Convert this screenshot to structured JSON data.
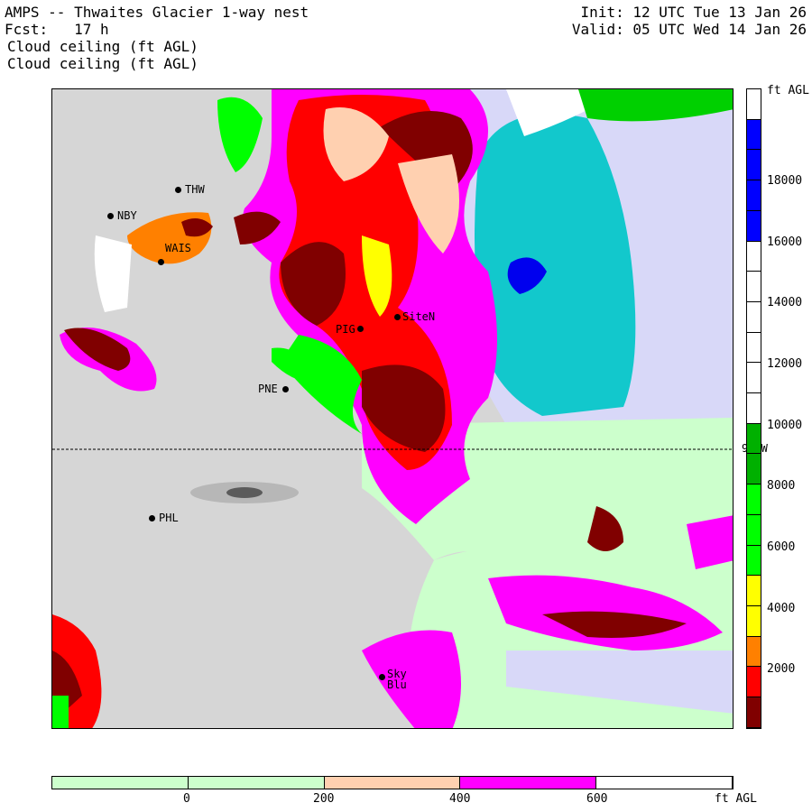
{
  "header": {
    "title": "AMPS -- Thwaites Glacier 1-way nest",
    "fcst": "Fcst:   17 h",
    "field1": "Cloud ceiling (ft AGL)",
    "field2": "Cloud ceiling (ft AGL)",
    "init": "Init: 12 UTC Tue 13 Jan 26",
    "valid": "Valid: 05 UTC Wed 14 Jan 26"
  },
  "stations": {
    "thw": "THW",
    "nby": "NBY",
    "wais": "WAIS",
    "pig": "PIG",
    "site": "SiteN",
    "pne": "PNE",
    "phl": "PHL",
    "sky": "Sky",
    "blu": "Blu"
  },
  "meridian_label": "90 W",
  "colorbar": {
    "unit": "ft AGL",
    "labels": [
      "18000",
      "16000",
      "14000",
      "12000",
      "10000",
      "8000",
      "6000",
      "4000",
      "2000"
    ],
    "bins": [
      {
        "min": 0,
        "max": 1000,
        "color": "#800000"
      },
      {
        "min": 1000,
        "max": 2000,
        "color": "#ff0000"
      },
      {
        "min": 2000,
        "max": 3000,
        "color": "#ff8000"
      },
      {
        "min": 3000,
        "max": 5000,
        "color": "#ffff00"
      },
      {
        "min": 5000,
        "max": 8000,
        "color": "#00ff00"
      },
      {
        "min": 8000,
        "max": 10000,
        "color": "#00b000"
      },
      {
        "min": 10000,
        "max": 16000,
        "color": "#ffffff"
      },
      {
        "min": 16000,
        "max": 20000,
        "color": "#0000ff"
      },
      {
        "min": 20000,
        "max": 21000,
        "color": "#ffffff"
      }
    ]
  },
  "bottombar": {
    "unit": "ft AGL",
    "labels": [
      "0",
      "200",
      "400",
      "600"
    ],
    "colors": [
      "#ccffcc",
      "#ccffcc",
      "#ffd0b0",
      "#ff00ff",
      "#ffffff"
    ]
  }
}
